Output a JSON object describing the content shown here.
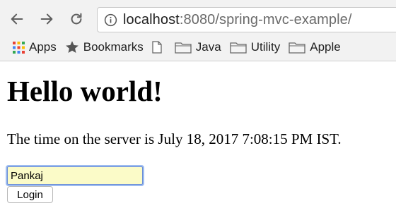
{
  "browser": {
    "url_host": "localhost",
    "url_path": ":8080/spring-mvc-example/",
    "nav_icons": [
      "back-arrow-icon",
      "forward-arrow-icon",
      "reload-icon",
      "info-icon"
    ],
    "bookmarks": [
      {
        "label": "Apps",
        "icon": "apps-grid-icon"
      },
      {
        "label": "Bookmarks",
        "icon": "star-icon"
      },
      {
        "label": "",
        "icon": "page-icon"
      },
      {
        "label": "Java",
        "icon": "folder-icon"
      },
      {
        "label": "Utility",
        "icon": "folder-icon"
      },
      {
        "label": "Apple",
        "icon": "folder-icon"
      }
    ]
  },
  "page": {
    "heading": "Hello world!",
    "server_time_text": "The time on the server is July 18, 2017 7:08:15 PM IST.",
    "user_field_value": "Pankaj",
    "login_label": "Login"
  },
  "colors": {
    "input_background": "#fbfbc8",
    "focus_ring": "#6d8fd6"
  }
}
